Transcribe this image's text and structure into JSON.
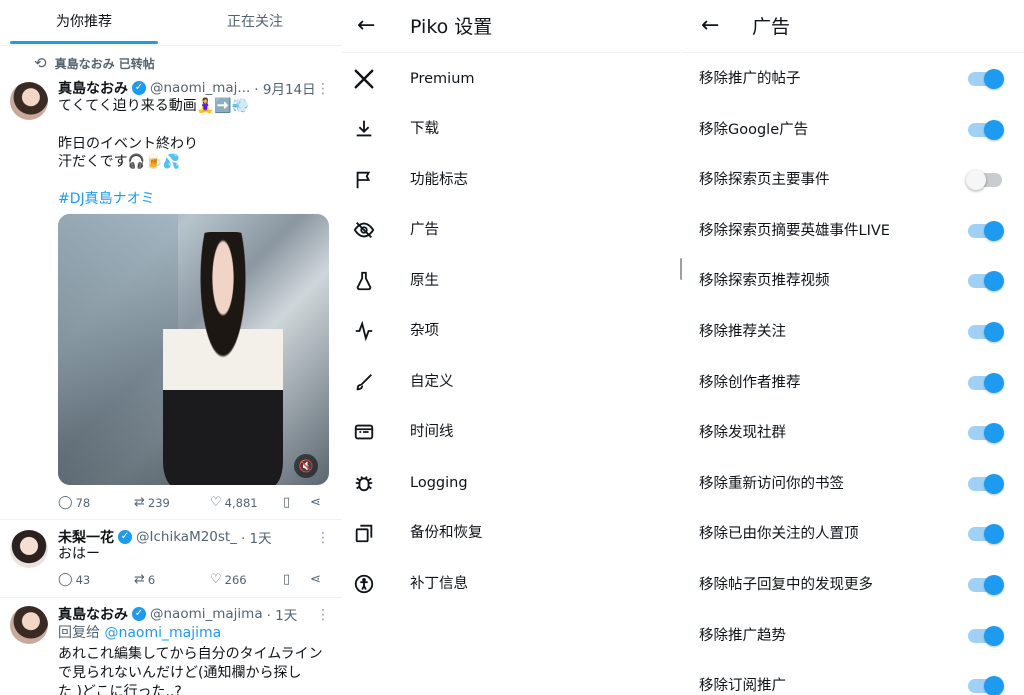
{
  "timeline": {
    "tabs": [
      "为你推荐",
      "正在关注"
    ],
    "retweet_label": "真島なおみ 已转帖",
    "tweets": [
      {
        "name": "真島なおみ",
        "handle": "@naomi_maj...",
        "time": "· 9月14日",
        "lines": [
          "てくてく迫り来る動画🧘‍♀️➡️💨",
          "",
          "昨日のイベント終わり",
          "汗だくです🎧🍺💦",
          "",
          "#DJ真島ナオミ"
        ],
        "replies": "78",
        "retweets": "239",
        "likes": "4,881"
      },
      {
        "name": "未梨一花",
        "handle": "@IchikaM20st_",
        "time": "· 1天",
        "lines": [
          "おはー"
        ],
        "replies": "43",
        "retweets": "6",
        "likes": "266"
      },
      {
        "name": "真島なおみ",
        "handle": "@naomi_majima",
        "time": "· 1天",
        "reply_prefix": "回复给",
        "reply_to": "@naomi_majima",
        "lines": [
          "あれこれ編集してから自分のタイムライン",
          "で見られないんだけど(通知欄から探し",
          "た )どこに行った..?"
        ]
      }
    ]
  },
  "settings": {
    "title": "Piko 设置",
    "items": [
      {
        "label": "Premium",
        "icon": "x-logo-icon"
      },
      {
        "label": "下载",
        "icon": "download-icon"
      },
      {
        "label": "功能标志",
        "icon": "flag-icon"
      },
      {
        "label": "广告",
        "icon": "ads-off-icon"
      },
      {
        "label": "原生",
        "icon": "flask-icon"
      },
      {
        "label": "杂项",
        "icon": "activity-icon"
      },
      {
        "label": "自定义",
        "icon": "brush-icon"
      },
      {
        "label": "时间线",
        "icon": "timeline-icon"
      },
      {
        "label": "Logging",
        "icon": "bug-icon"
      },
      {
        "label": "备份和恢复",
        "icon": "backup-icon"
      },
      {
        "label": "补丁信息",
        "icon": "info-icon"
      }
    ]
  },
  "ads": {
    "title": "广告",
    "accent": "#1d9bf0",
    "rows": [
      {
        "label": "移除推广的帖子",
        "on": true
      },
      {
        "label": "移除Google广告",
        "on": true
      },
      {
        "label": "移除探索页主要事件",
        "on": false
      },
      {
        "label": "移除探索页摘要英雄事件LIVE",
        "on": true
      },
      {
        "label": "移除探索页推荐视频",
        "on": true
      },
      {
        "label": "移除推荐关注",
        "on": true
      },
      {
        "label": "移除创作者推荐",
        "on": true
      },
      {
        "label": "移除发现社群",
        "on": true
      },
      {
        "label": "移除重新访问你的书签",
        "on": true
      },
      {
        "label": "移除已由你关注的人置顶",
        "on": true
      },
      {
        "label": "移除帖子回复中的发现更多",
        "on": true
      },
      {
        "label": "移除推广趋势",
        "on": true
      },
      {
        "label": "移除订阅推广",
        "on": true
      }
    ]
  }
}
